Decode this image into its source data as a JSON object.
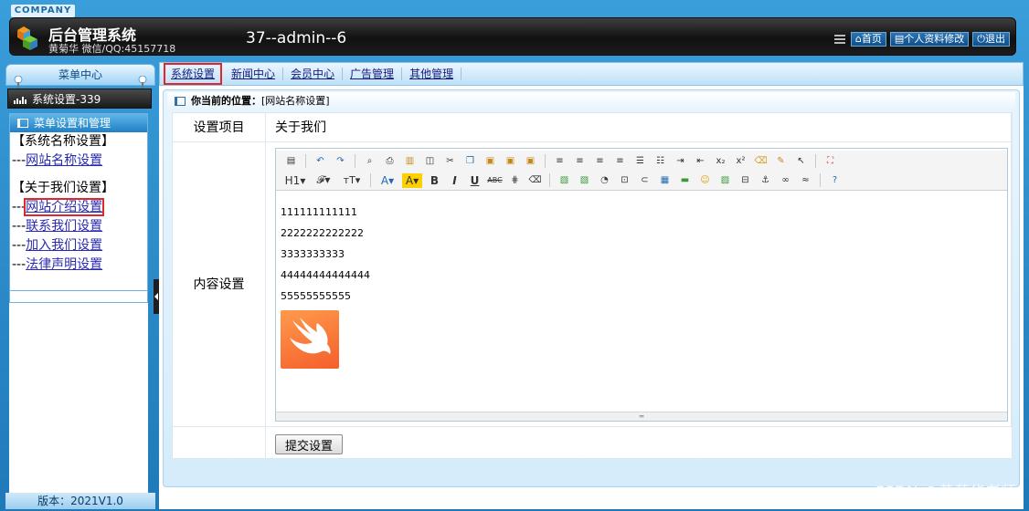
{
  "header": {
    "company": "COMPANY",
    "title": "后台管理系统",
    "subtitle": "黄菊华 微信/QQ:45157718",
    "user_info": "37--admin--6",
    "nav": [
      {
        "label": "首页",
        "icon": "home-icon"
      },
      {
        "label": "个人资料修改",
        "icon": "profile-icon"
      },
      {
        "label": "退出",
        "icon": "power-icon"
      }
    ]
  },
  "sidebar": {
    "menu_title": "菜单中心",
    "section": "系统设置-339",
    "panel_title": "菜单设置和管理",
    "group1": "【系统名称设置】",
    "group1_items": [
      "网站名称设置"
    ],
    "group2": "【关于我们设置】",
    "group2_items": [
      "网站介绍设置",
      "联系我们设置",
      "加入我们设置",
      "法律声明设置"
    ],
    "item_prefix": "---",
    "version": "版本：2021V1.0"
  },
  "tabs": [
    "系统设置",
    "新闻中心",
    "会员中心",
    "广告管理",
    "其他管理"
  ],
  "active_tab": "系统设置",
  "breadcrumb": {
    "label": "你当前的位置：",
    "value": "[网站名称设置]"
  },
  "form": {
    "row1_label": "设置项目",
    "row1_value": "关于我们",
    "row2_label": "内容设置",
    "editor_lines": [
      "111111111111",
      "2222222222222",
      "3333333333",
      "44444444444444",
      "55555555555"
    ],
    "submit_label": "提交设置"
  },
  "watermark": "CSDN @黄菊华老师",
  "colors": {
    "accent": "#2a8fd0",
    "highlight": "#e0272c",
    "link": "#2a2ab2"
  }
}
